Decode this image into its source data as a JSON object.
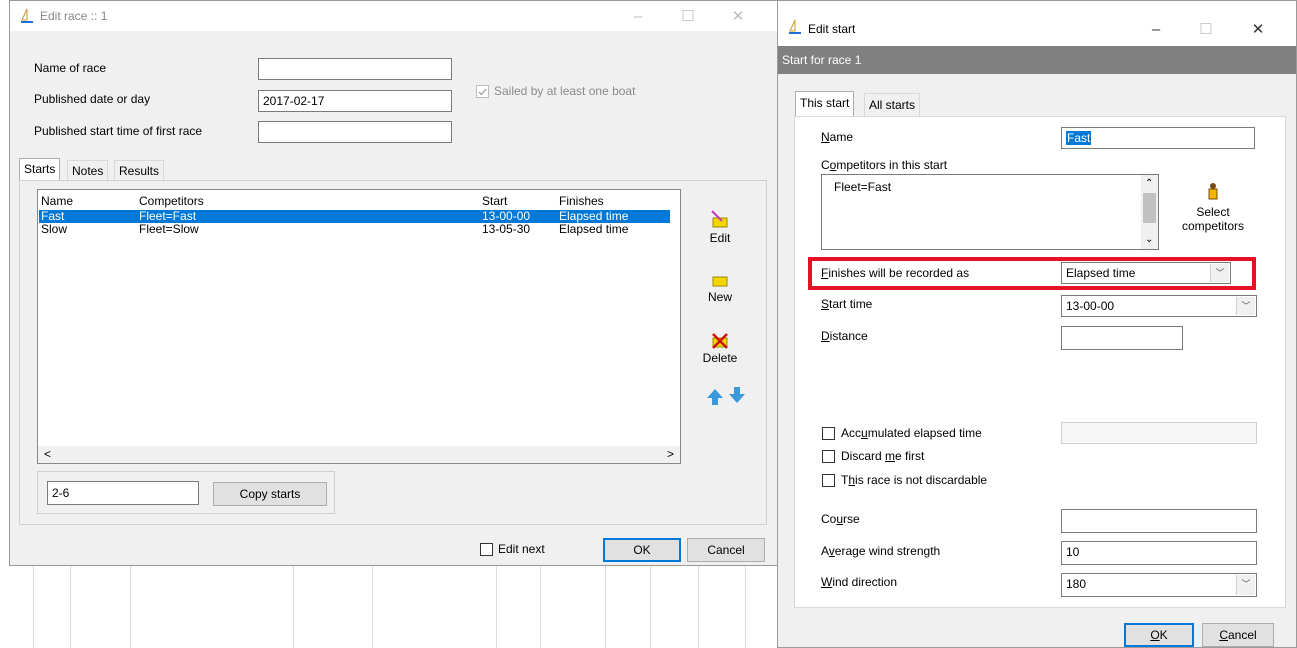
{
  "edit_race": {
    "title": "Edit race :: 1",
    "name_label": "Name of race",
    "name_value": "",
    "date_label": "Published date or day",
    "date_value": "2017-02-17",
    "start_time_label": "Published start time of first race",
    "start_time_value": "",
    "sailed_label": "Sailed by at least one boat",
    "tabs": [
      "Starts",
      "Notes",
      "Results"
    ],
    "list_headers": [
      "Name",
      "Competitors",
      "Start",
      "Finishes"
    ],
    "rows": [
      [
        "Fast",
        "Fleet=Fast",
        "13-00-00",
        "Elapsed time"
      ],
      [
        "Slow",
        "Fleet=Slow",
        "13-05-30",
        "Elapsed time"
      ]
    ],
    "tools": {
      "edit": "Edit",
      "new": "New",
      "delete": "Delete"
    },
    "copy_value": "2-6",
    "copy_button": "Copy starts",
    "edit_next_label": "Edit next",
    "ok": "OK",
    "cancel": "Cancel"
  },
  "edit_start": {
    "title": "Edit start",
    "header": "Start for race 1",
    "tabs": [
      "This start",
      "All starts"
    ],
    "name_label": "Name",
    "name_value": "Fast",
    "competitors_label": "Competitors in this start",
    "competitors_value": "Fleet=Fast",
    "select_competitors": "Select competitors",
    "finishes_label": "Finishes will be recorded as",
    "finishes_value": "Elapsed time",
    "start_time_label": "Start time",
    "start_time_value": "13-00-00",
    "distance_label": "Distance",
    "distance_value": "",
    "accumulated_label": "Accumulated elapsed time",
    "discard_label": "Discard me first",
    "not_discardable_label": "This race is not discardable",
    "course_label": "Course",
    "course_value": "",
    "wind_strength_label": "Average wind strength",
    "wind_strength_value": "10",
    "wind_direction_label": "Wind direction",
    "wind_direction_value": "180",
    "ok": "OK",
    "cancel": "Cancel"
  },
  "colors": {
    "selection": "#0078d7",
    "highlight_box": "#e81123",
    "header_bar": "#808080"
  }
}
